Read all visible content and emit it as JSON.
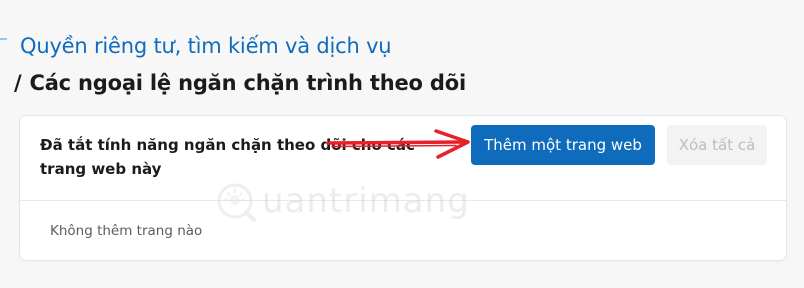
{
  "header": {
    "back_link": "Quyền riêng tư, tìm kiếm và dịch vụ",
    "separator": "/",
    "title": "Các ngoại lệ ngăn chặn trình theo dõi"
  },
  "card": {
    "description": "Đã tắt tính năng ngăn chặn theo dõi cho các trang web này",
    "add_button_label": "Thêm một trang web",
    "clear_all_label": "Xóa tất cả",
    "empty_message": "Không thêm trang nào"
  },
  "watermark": {
    "text": "uantrimang"
  },
  "colors": {
    "accent": "#0f6cbd",
    "annotation_arrow": "#e8202a",
    "background": "#f7f7f7"
  }
}
